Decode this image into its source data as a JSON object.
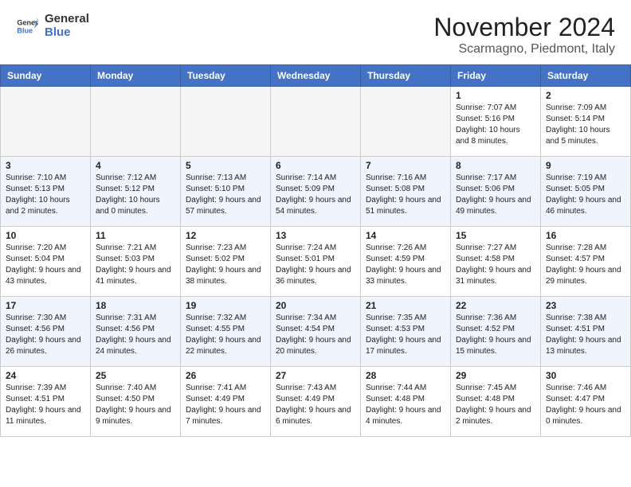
{
  "header": {
    "logo_text_general": "General",
    "logo_text_blue": "Blue",
    "month_title": "November 2024",
    "location": "Scarmagno, Piedmont, Italy"
  },
  "weekdays": [
    "Sunday",
    "Monday",
    "Tuesday",
    "Wednesday",
    "Thursday",
    "Friday",
    "Saturday"
  ],
  "weeks": [
    [
      {
        "day": "",
        "empty": true
      },
      {
        "day": "",
        "empty": true
      },
      {
        "day": "",
        "empty": true
      },
      {
        "day": "",
        "empty": true
      },
      {
        "day": "",
        "empty": true
      },
      {
        "day": "1",
        "sunrise": "7:07 AM",
        "sunset": "5:16 PM",
        "daylight": "10 hours and 8 minutes."
      },
      {
        "day": "2",
        "sunrise": "7:09 AM",
        "sunset": "5:14 PM",
        "daylight": "10 hours and 5 minutes."
      }
    ],
    [
      {
        "day": "3",
        "sunrise": "7:10 AM",
        "sunset": "5:13 PM",
        "daylight": "10 hours and 2 minutes."
      },
      {
        "day": "4",
        "sunrise": "7:12 AM",
        "sunset": "5:12 PM",
        "daylight": "10 hours and 0 minutes."
      },
      {
        "day": "5",
        "sunrise": "7:13 AM",
        "sunset": "5:10 PM",
        "daylight": "9 hours and 57 minutes."
      },
      {
        "day": "6",
        "sunrise": "7:14 AM",
        "sunset": "5:09 PM",
        "daylight": "9 hours and 54 minutes."
      },
      {
        "day": "7",
        "sunrise": "7:16 AM",
        "sunset": "5:08 PM",
        "daylight": "9 hours and 51 minutes."
      },
      {
        "day": "8",
        "sunrise": "7:17 AM",
        "sunset": "5:06 PM",
        "daylight": "9 hours and 49 minutes."
      },
      {
        "day": "9",
        "sunrise": "7:19 AM",
        "sunset": "5:05 PM",
        "daylight": "9 hours and 46 minutes."
      }
    ],
    [
      {
        "day": "10",
        "sunrise": "7:20 AM",
        "sunset": "5:04 PM",
        "daylight": "9 hours and 43 minutes."
      },
      {
        "day": "11",
        "sunrise": "7:21 AM",
        "sunset": "5:03 PM",
        "daylight": "9 hours and 41 minutes."
      },
      {
        "day": "12",
        "sunrise": "7:23 AM",
        "sunset": "5:02 PM",
        "daylight": "9 hours and 38 minutes."
      },
      {
        "day": "13",
        "sunrise": "7:24 AM",
        "sunset": "5:01 PM",
        "daylight": "9 hours and 36 minutes."
      },
      {
        "day": "14",
        "sunrise": "7:26 AM",
        "sunset": "4:59 PM",
        "daylight": "9 hours and 33 minutes."
      },
      {
        "day": "15",
        "sunrise": "7:27 AM",
        "sunset": "4:58 PM",
        "daylight": "9 hours and 31 minutes."
      },
      {
        "day": "16",
        "sunrise": "7:28 AM",
        "sunset": "4:57 PM",
        "daylight": "9 hours and 29 minutes."
      }
    ],
    [
      {
        "day": "17",
        "sunrise": "7:30 AM",
        "sunset": "4:56 PM",
        "daylight": "9 hours and 26 minutes."
      },
      {
        "day": "18",
        "sunrise": "7:31 AM",
        "sunset": "4:56 PM",
        "daylight": "9 hours and 24 minutes."
      },
      {
        "day": "19",
        "sunrise": "7:32 AM",
        "sunset": "4:55 PM",
        "daylight": "9 hours and 22 minutes."
      },
      {
        "day": "20",
        "sunrise": "7:34 AM",
        "sunset": "4:54 PM",
        "daylight": "9 hours and 20 minutes."
      },
      {
        "day": "21",
        "sunrise": "7:35 AM",
        "sunset": "4:53 PM",
        "daylight": "9 hours and 17 minutes."
      },
      {
        "day": "22",
        "sunrise": "7:36 AM",
        "sunset": "4:52 PM",
        "daylight": "9 hours and 15 minutes."
      },
      {
        "day": "23",
        "sunrise": "7:38 AM",
        "sunset": "4:51 PM",
        "daylight": "9 hours and 13 minutes."
      }
    ],
    [
      {
        "day": "24",
        "sunrise": "7:39 AM",
        "sunset": "4:51 PM",
        "daylight": "9 hours and 11 minutes."
      },
      {
        "day": "25",
        "sunrise": "7:40 AM",
        "sunset": "4:50 PM",
        "daylight": "9 hours and 9 minutes."
      },
      {
        "day": "26",
        "sunrise": "7:41 AM",
        "sunset": "4:49 PM",
        "daylight": "9 hours and 7 minutes."
      },
      {
        "day": "27",
        "sunrise": "7:43 AM",
        "sunset": "4:49 PM",
        "daylight": "9 hours and 6 minutes."
      },
      {
        "day": "28",
        "sunrise": "7:44 AM",
        "sunset": "4:48 PM",
        "daylight": "9 hours and 4 minutes."
      },
      {
        "day": "29",
        "sunrise": "7:45 AM",
        "sunset": "4:48 PM",
        "daylight": "9 hours and 2 minutes."
      },
      {
        "day": "30",
        "sunrise": "7:46 AM",
        "sunset": "4:47 PM",
        "daylight": "9 hours and 0 minutes."
      }
    ]
  ]
}
